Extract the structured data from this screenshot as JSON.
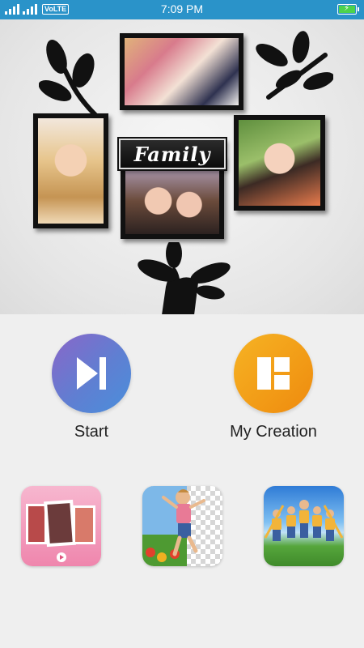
{
  "status_bar": {
    "network_badge": "VoLTE",
    "time": "7:09 PM",
    "battery_icon": "battery-charging-icon",
    "signal_icon": "signal-bars-icon"
  },
  "hero": {
    "plaque_text": "Family"
  },
  "actions": {
    "start_label": "Start",
    "creation_label": "My Creation",
    "start_icon": "play-next-icon",
    "creation_icon": "layout-grid-icon"
  },
  "shortcuts": [
    {
      "icon": "photo-collage-video-icon"
    },
    {
      "icon": "cut-paste-photo-icon"
    },
    {
      "icon": "mirror-photo-icon"
    }
  ],
  "colors": {
    "status_bar": "#2a93c9",
    "start_gradient": [
      "#8a66c8",
      "#4a8fdb"
    ],
    "creation_gradient": [
      "#f6b324",
      "#ee8a0f"
    ]
  }
}
